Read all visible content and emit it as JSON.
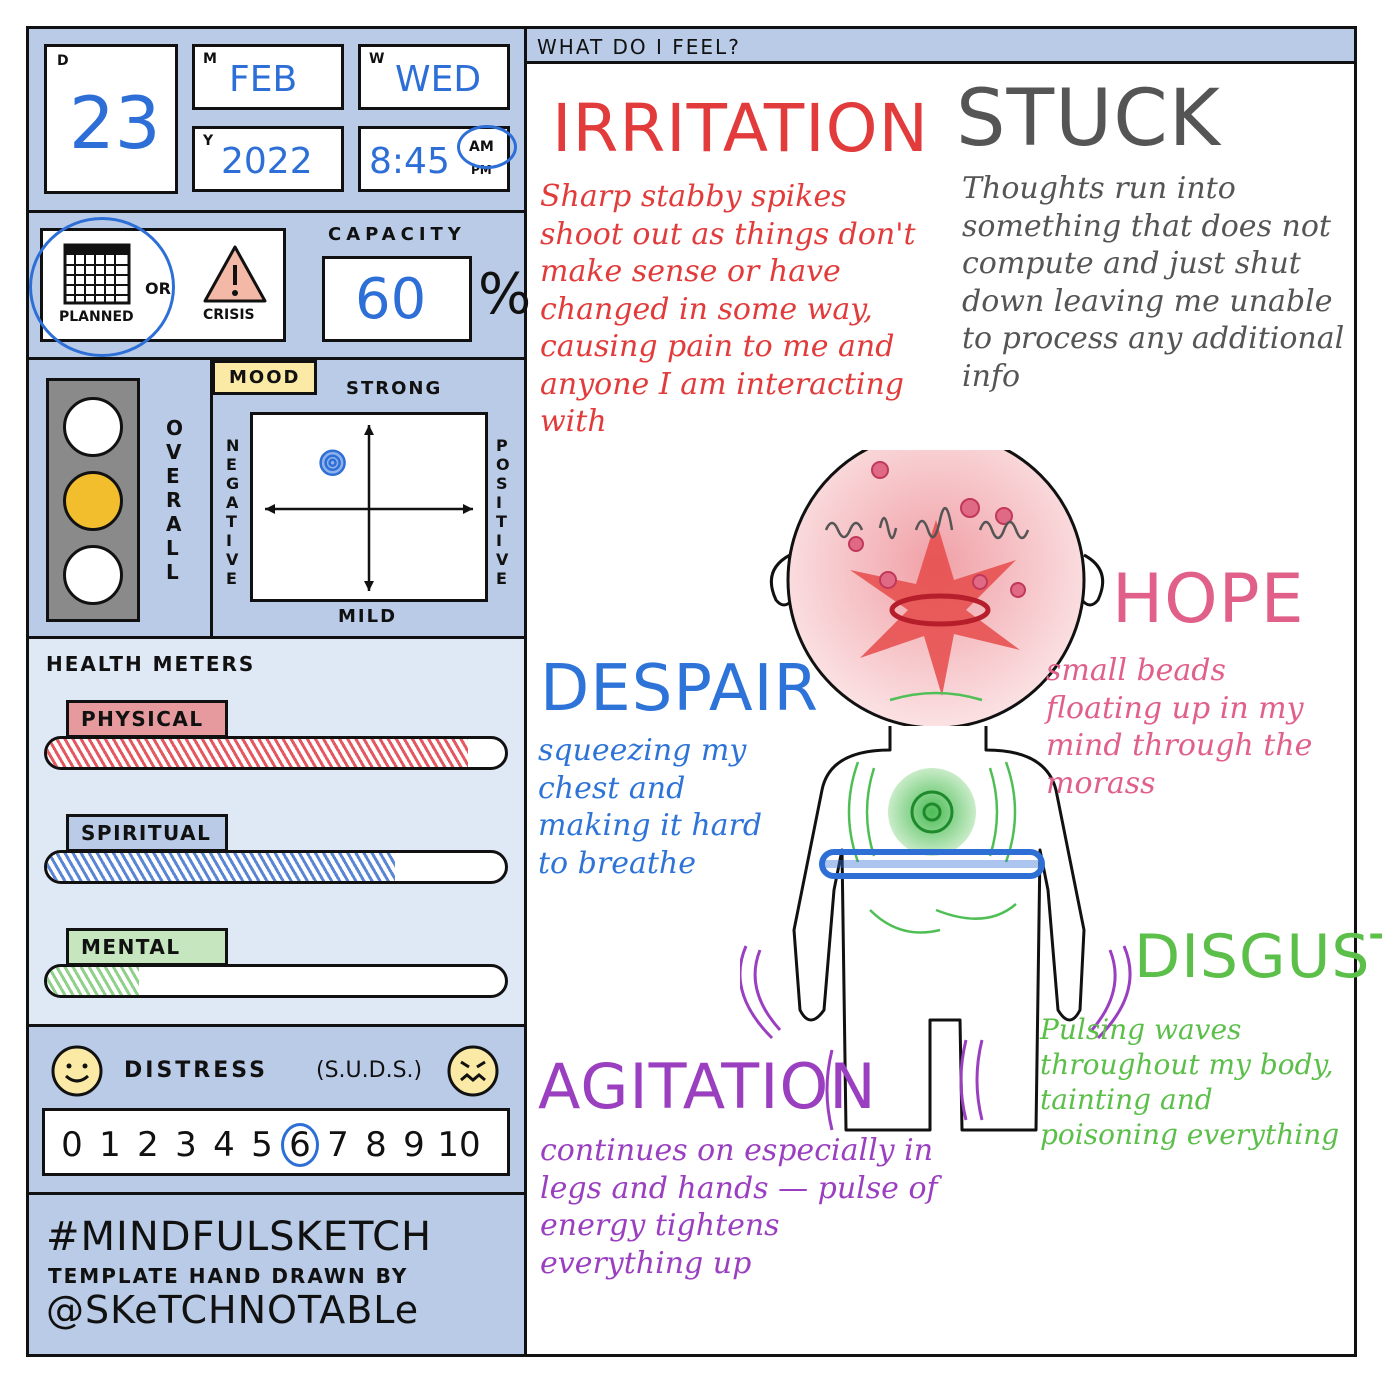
{
  "date": {
    "day_label": "D",
    "day": "23",
    "month_label": "M",
    "month": "FEB",
    "weekday_label": "W",
    "weekday": "WED",
    "year_label": "Y",
    "year": "2022",
    "time": "8:45",
    "am": "AM",
    "pm": "PM",
    "selected_meridiem": "AM"
  },
  "mode": {
    "planned": "PLANNED",
    "or": "OR",
    "crisis": "CRISIS",
    "selected": "PLANNED"
  },
  "capacity": {
    "label": "CAPACITY",
    "value": "60",
    "unit": "%"
  },
  "overall": {
    "label": "OVERALL",
    "light": "yellow"
  },
  "mood": {
    "label": "MOOD",
    "top": "STRONG",
    "bottom": "MILD",
    "left": "NEGATIVE",
    "right": "POSITIVE",
    "point_x": -0.35,
    "point_y": 0.55
  },
  "health": {
    "title": "HEALTH METERS",
    "meters": [
      {
        "label": "PHYSICAL",
        "level": 0.92,
        "color": "#e5585f",
        "tab": "#e79a9d"
      },
      {
        "label": "SPIRITUAL",
        "level": 0.76,
        "color": "#5b86d6",
        "tab": "#b9cbe6"
      },
      {
        "label": "MENTAL",
        "level": 0.2,
        "color": "#8fd08a",
        "tab": "#c6e6bf"
      }
    ]
  },
  "distress": {
    "title": "DISTRESS",
    "suds": "(S.U.D.S.)",
    "scale": [
      "0",
      "1",
      "2",
      "3",
      "4",
      "5",
      "6",
      "7",
      "8",
      "9",
      "10"
    ],
    "selected": "6"
  },
  "footer": {
    "hashtag": "#MINDFULSKETCH",
    "credit": "TEMPLATE HAND DRAWN BY",
    "handle": "@SKeTCHNOTABLe"
  },
  "feel": {
    "header": "WHAT DO I FEEL?",
    "irritation": {
      "title": "IRRITATION",
      "text": "Sharp stabby spikes shoot out as things don't make sense or have changed in some way, causing pain to me and anyone I am interacting with",
      "color": "#e23b3b"
    },
    "stuck": {
      "title": "STUCK",
      "text": "Thoughts run into something that does not compute and just shut down leaving me unable to process any additional info",
      "color": "#555555"
    },
    "despair": {
      "title": "DESPAIR",
      "text": "squeezing my chest and making it hard to breathe",
      "color": "#2e74d8"
    },
    "hope": {
      "title": "HOPE",
      "text": "small beads floating up in my mind through the morass",
      "color": "#e0608a"
    },
    "disgust": {
      "title": "DISGUST",
      "text": "Pulsing waves throughout my body, tainting and poisoning everything",
      "color": "#5bbf4a"
    },
    "agitation": {
      "title": "AGITATION",
      "text": "continues on especially in legs and hands — pulse of energy tightens everything up",
      "color": "#9a3fc0"
    }
  }
}
